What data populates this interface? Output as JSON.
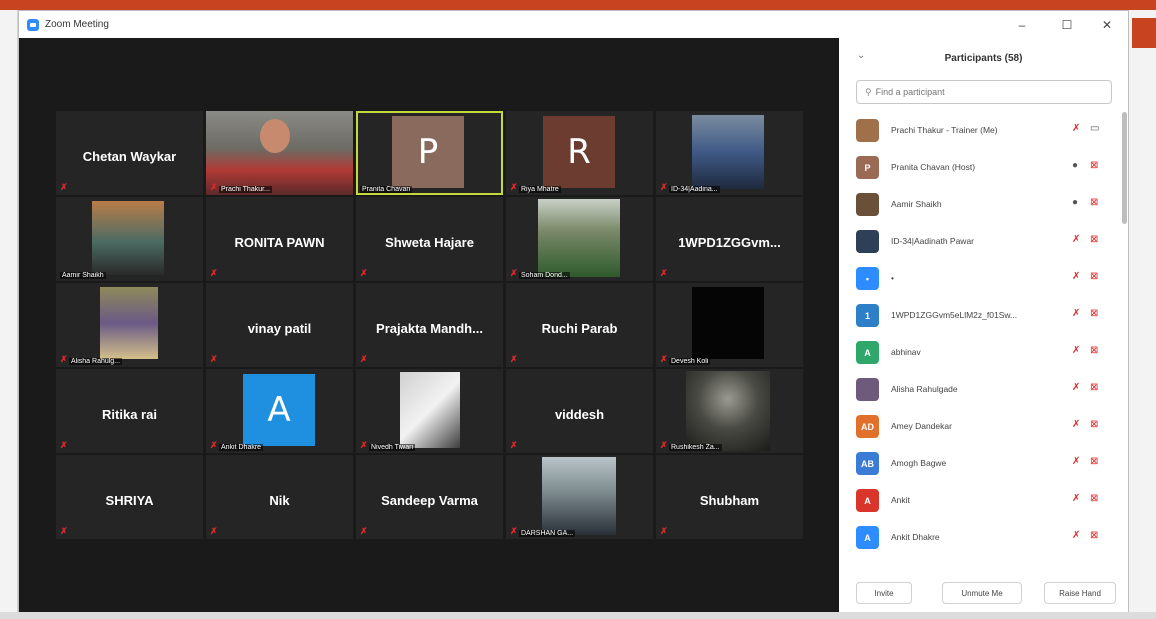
{
  "window": {
    "title": "Zoom Meeting",
    "minimize": "–",
    "maximize": "☐",
    "close": "✕"
  },
  "colors": {
    "mute": "#e02828",
    "active_speaker": "#c4d93a",
    "tile_bg": "#252525",
    "accent": "#2d8cff"
  },
  "tiles": [
    {
      "name": "Chetan Waykar",
      "label": ""
    },
    {
      "name": "",
      "label": "Prachi Thakur..."
    },
    {
      "name": "",
      "label": "Pranita Chavan",
      "letter": "P"
    },
    {
      "name": "",
      "label": "Riya Mhatre",
      "letter": "R"
    },
    {
      "name": "",
      "label": "ID-34|Aadina..."
    },
    {
      "name": "",
      "label": "Aamir Shaikh"
    },
    {
      "name": "RONITA PAWN",
      "label": ""
    },
    {
      "name": "Shweta Hajare",
      "label": ""
    },
    {
      "name": "",
      "label": "Soham Dond..."
    },
    {
      "name": "1WPD1ZGGvm...",
      "label": ""
    },
    {
      "name": "",
      "label": "Alisha Rahulg..."
    },
    {
      "name": "vinay patil",
      "label": ""
    },
    {
      "name": "Prajakta  Mandh...",
      "label": ""
    },
    {
      "name": "Ruchi Parab",
      "label": ""
    },
    {
      "name": "",
      "label": "Devesh Koli"
    },
    {
      "name": "Ritika rai",
      "label": ""
    },
    {
      "name": "",
      "label": "Ankit Dhakre",
      "letter": "A"
    },
    {
      "name": "",
      "label": "Nivedh Tiwari"
    },
    {
      "name": "viddesh",
      "label": ""
    },
    {
      "name": "",
      "label": "Rushikesh Za..."
    },
    {
      "name": "SHRIYA",
      "label": ""
    },
    {
      "name": "Nik",
      "label": ""
    },
    {
      "name": "Sandeep Varma",
      "label": ""
    },
    {
      "name": "",
      "label": "DARSHAN GA..."
    },
    {
      "name": "Shubham",
      "label": ""
    }
  ],
  "panel": {
    "title": "Participants (58)",
    "collapse_icon": "⌄",
    "search_icon": "⚲",
    "search_placeholder": "Find a participant",
    "participants": [
      {
        "name": "Prachi Thakur - Trainer (Me)",
        "avatar": "",
        "avatar_color": "#a0704a",
        "mic": "muted",
        "cam": "on"
      },
      {
        "name": "Pranita Chavan (Host)",
        "avatar": "P",
        "avatar_color": "#9a6a55",
        "mic": "on",
        "cam": "off"
      },
      {
        "name": "Aamir Shaikh",
        "avatar": "",
        "avatar_color": "#6a5038",
        "mic": "on",
        "cam": "off"
      },
      {
        "name": "ID-34|Aadinath Pawar",
        "avatar": "",
        "avatar_color": "#2e3f58",
        "mic": "muted",
        "cam": "off"
      },
      {
        "name": "•",
        "avatar": "•",
        "avatar_color": "#2d8cff",
        "mic": "muted",
        "cam": "off"
      },
      {
        "name": "1WPD1ZGGvm5eLlM2z_f01Sw...",
        "avatar": "1",
        "avatar_color": "#2d7fc8",
        "mic": "muted",
        "cam": "off"
      },
      {
        "name": "abhinav",
        "avatar": "A",
        "avatar_color": "#2fa76a",
        "mic": "muted",
        "cam": "off"
      },
      {
        "name": "Alisha Rahulgade",
        "avatar": "",
        "avatar_color": "#6e5a7a",
        "mic": "muted",
        "cam": "off"
      },
      {
        "name": "Amey Dandekar",
        "avatar": "AD",
        "avatar_color": "#e0702a",
        "mic": "muted",
        "cam": "off"
      },
      {
        "name": "Amogh Bagwe",
        "avatar": "AB",
        "avatar_color": "#3a7bd5",
        "mic": "muted",
        "cam": "off"
      },
      {
        "name": "Ankit",
        "avatar": "A",
        "avatar_color": "#d9352a",
        "mic": "muted",
        "cam": "off"
      },
      {
        "name": "Ankit Dhakre",
        "avatar": "A",
        "avatar_color": "#2d8cff",
        "mic": "muted",
        "cam": "off"
      }
    ],
    "buttons": {
      "invite": "Invite",
      "unmute": "Unmute Me",
      "raise_hand": "Raise Hand"
    }
  }
}
